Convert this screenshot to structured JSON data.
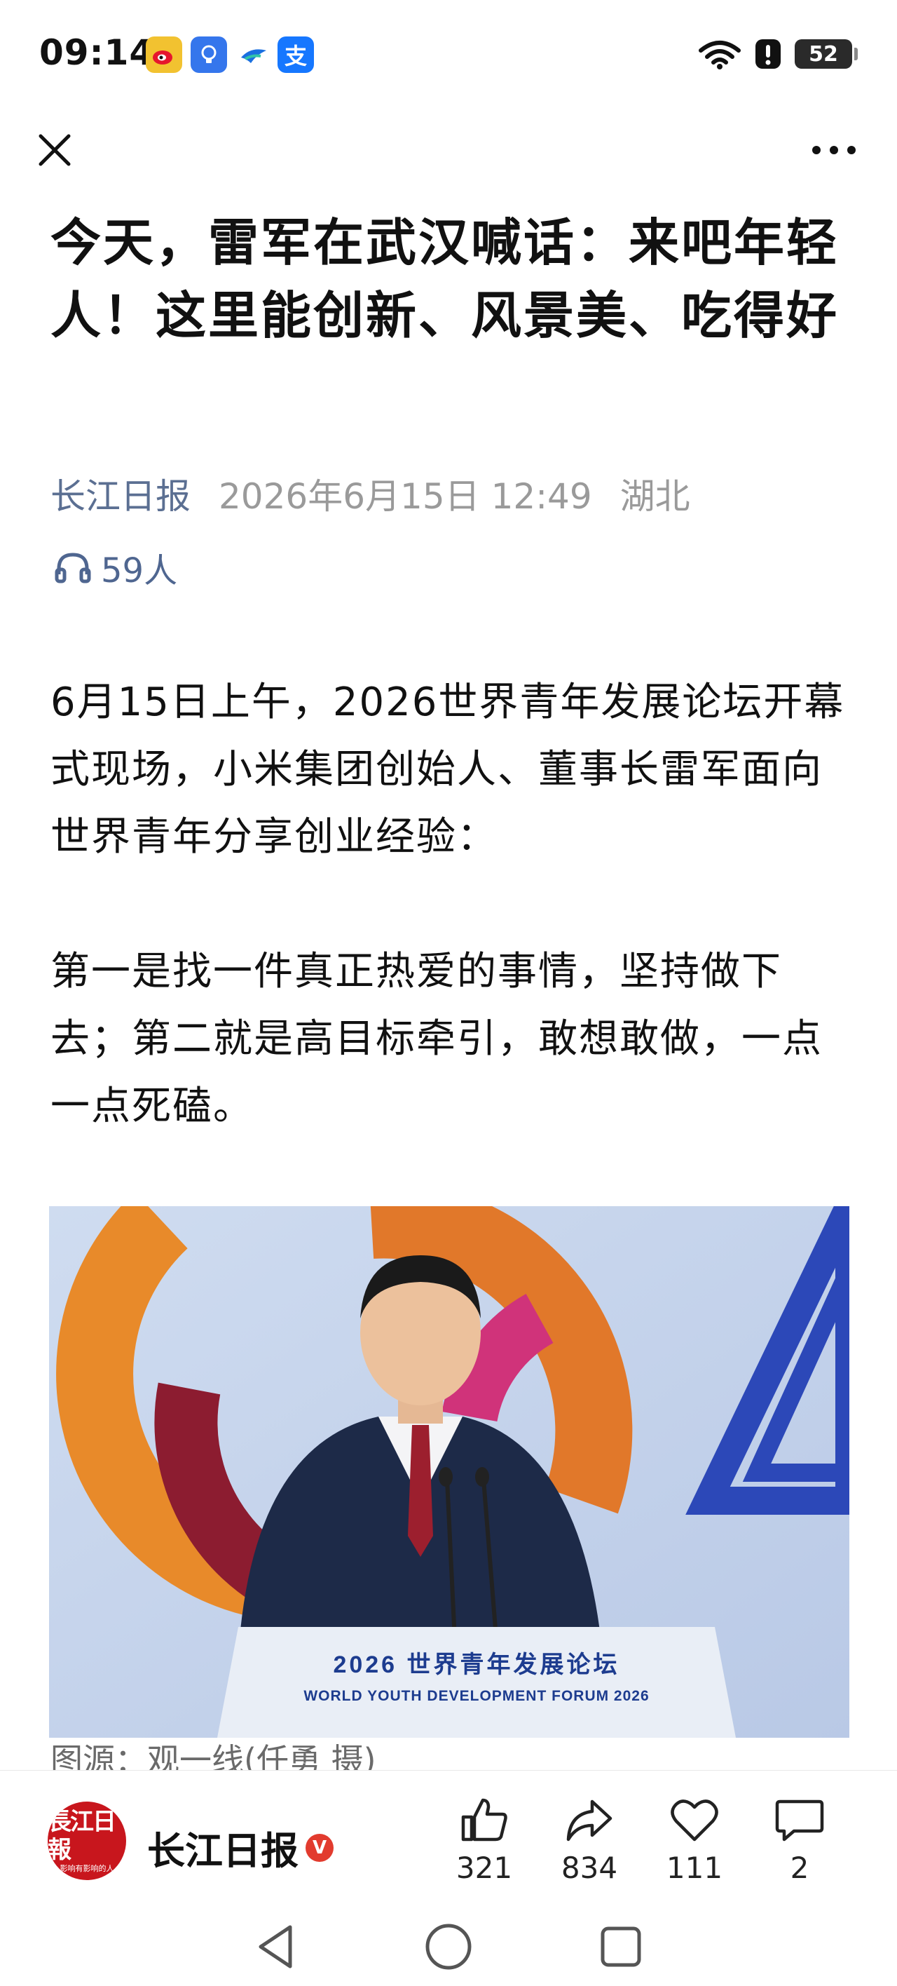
{
  "status_bar": {
    "time": "09:14",
    "notification_icons": [
      "weibo-icon",
      "bulb-app-icon",
      "bird-app-icon",
      "alipay-icon"
    ],
    "alipay_glyph": "支",
    "battery_level": "52",
    "signal_icons": [
      "wifi-icon",
      "alert-icon"
    ]
  },
  "toolbar": {
    "close_icon": "close-icon",
    "more_icon": "more-icon"
  },
  "article": {
    "title": "今天，雷军在武汉喊话：来吧年轻人！这里能创新、风景美、吃得好",
    "source": "长江日报",
    "datetime": "2026年6月15日 12:49",
    "region": "湖北",
    "listeners": "59人",
    "paragraphs": [
      "6月15日上午，2026世界青年发展论坛开幕式现场，小米集团创始人、董事长雷军面向世界青年分享创业经验：",
      "第一是找一件真正热爱的事情，坚持做下去；第二就是高目标牵引，敢想敢做，一点一点死磕。"
    ],
    "photo": {
      "podium_title": "2026 世界青年发展论坛",
      "podium_subtitle": "WORLD YOUTH DEVELOPMENT FORUM 2026"
    },
    "caption": "图源：观一线(任勇 摄)"
  },
  "bottom_bar": {
    "logo_text": "長江日報",
    "logo_slogan": "影响有影响的人",
    "publisher_name": "长江日报",
    "verified_badge": "V",
    "like_count": "321",
    "share_count": "834",
    "favorite_count": "111",
    "comment_count": "2"
  },
  "colors": {
    "accent_source": "#5b6f92",
    "meta_gray": "#9a9a9a",
    "logo_red": "#c8161d",
    "badge_red": "#e23b2e"
  }
}
